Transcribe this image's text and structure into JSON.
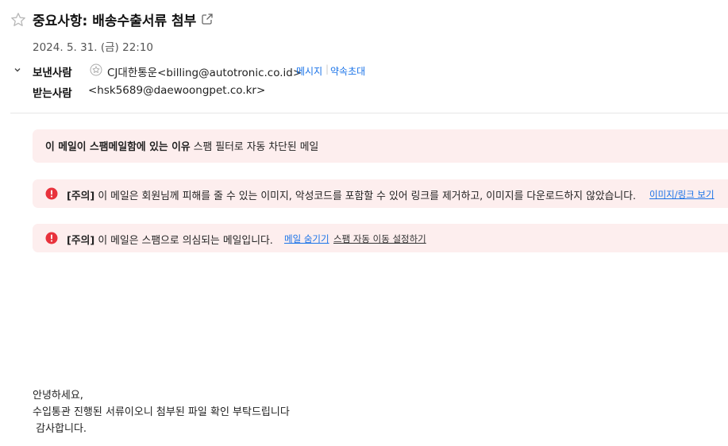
{
  "header": {
    "subject": "중요사항: 배송수출서류 첨부",
    "date": "2024. 5. 31. (금) 22:10"
  },
  "sender": {
    "label": "보낸사람",
    "value": "CJ대한통운<billing@autotronic.co.id>",
    "message_link": "메시지",
    "separator": "|",
    "appointment_link": "약속초대"
  },
  "recipient": {
    "label": "받는사람",
    "value": "<hsk5689@daewoongpet.co.kr>"
  },
  "spam_reason": {
    "label": "이 메일이 스팸메일함에 있는 이유",
    "text": "스팸 필터로 자동 차단된 메일"
  },
  "warning_images": {
    "tag": "[주의]",
    "text": "이 메일은 회원님께 피해를 줄 수 있는 이미지, 악성코드를 포함할 수 있어 링크를 제거하고, 이미지를 다운로드하지 않았습니다.",
    "link": "이미지/링크 보기"
  },
  "warning_spam": {
    "tag": "[주의]",
    "text": "이 메일은 스팸으로 의심되는 메일입니다.",
    "hide_link": "메일 숨기기",
    "auto_move_link": "스팸 자동 이동 설정하기"
  },
  "body": {
    "line1": "안녕하세요,",
    "line2": "수입통관 진행된 서류이오니 첨부된 파일 확인 부탁드립니다",
    "line3": " 감사합니다."
  },
  "colors": {
    "link": "#1a73e8",
    "warning_bg": "#fdeeee",
    "warning_icon": "#e8323c"
  },
  "icons": [
    "star-icon",
    "external-link-icon",
    "chevron-down-icon",
    "sender-profile-icon",
    "warning-icon"
  ]
}
